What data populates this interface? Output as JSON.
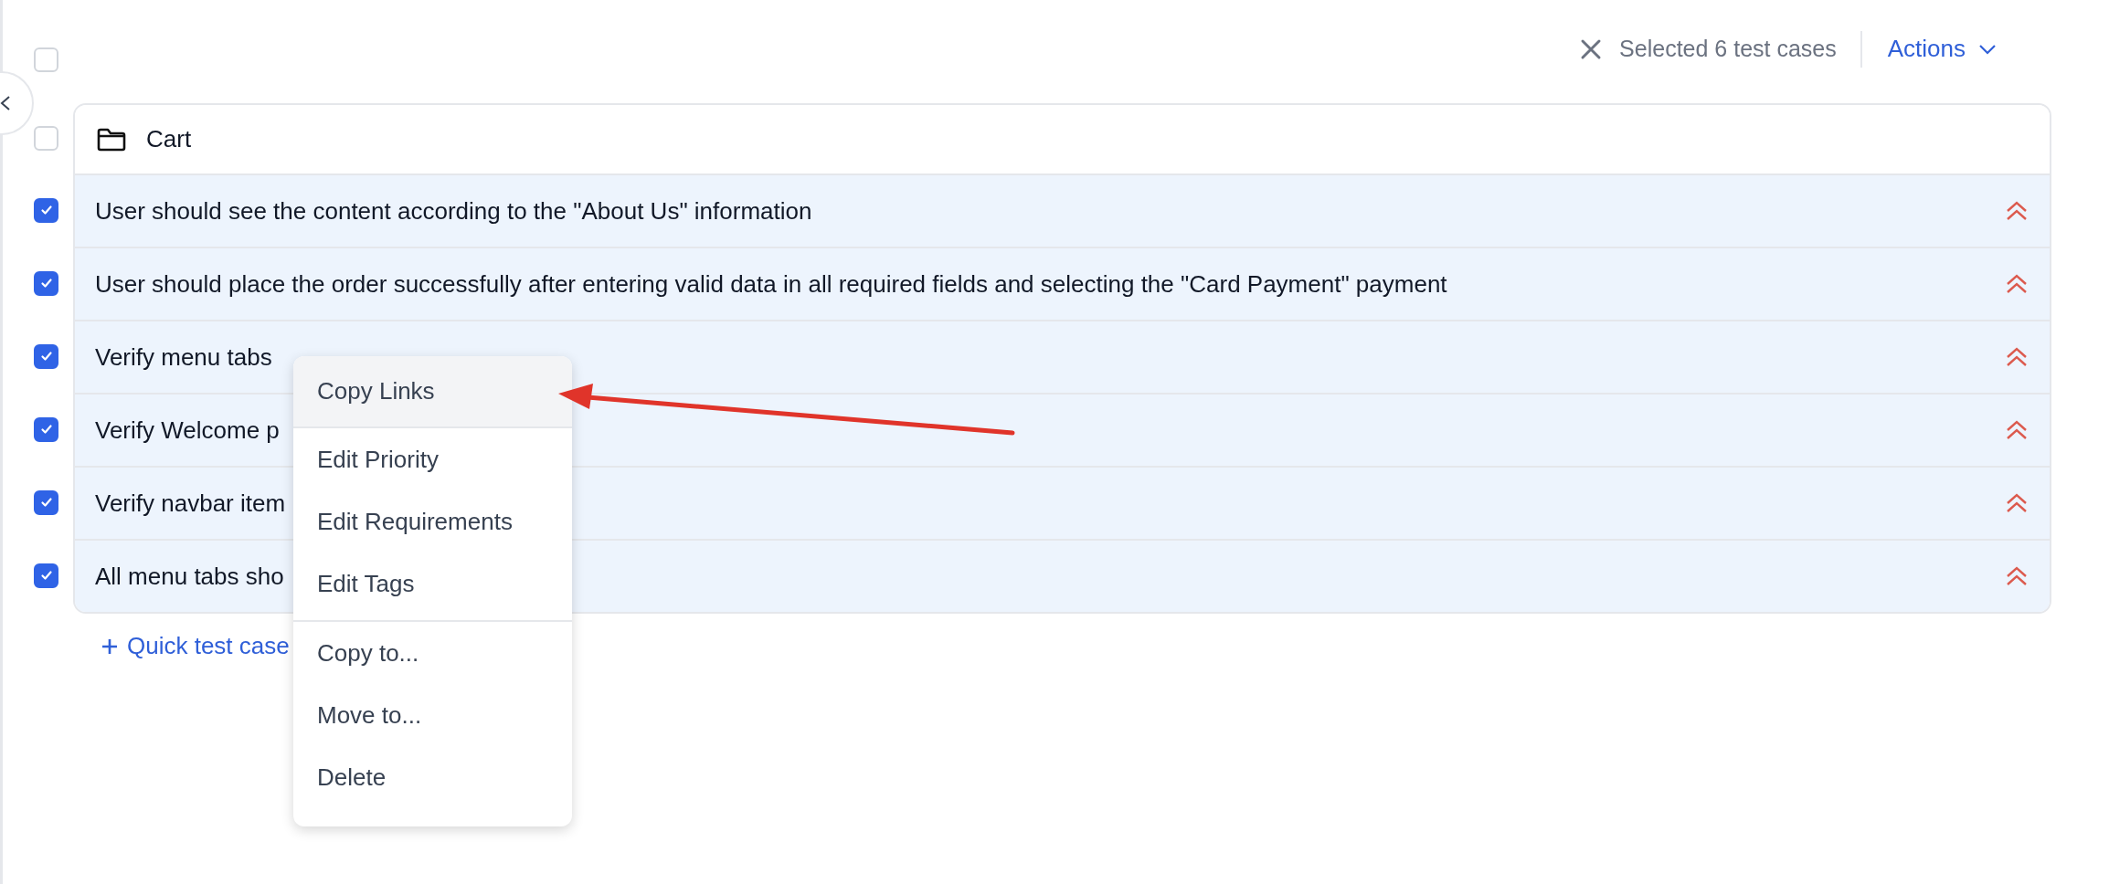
{
  "toolbar": {
    "select_all": {
      "checked": false
    },
    "selection_text": "Selected 6 test cases",
    "actions_label": "Actions"
  },
  "folder": {
    "name": "Cart",
    "checked": false
  },
  "test_cases": [
    {
      "title": "User should see the content according to the \"About Us\" information",
      "checked": true
    },
    {
      "title": "User should place the order successfully after entering valid data in all required fields and selecting the \"Card Payment\" payment",
      "checked": true
    },
    {
      "title": "Verify menu tabs",
      "checked": true
    },
    {
      "title": "Verify Welcome p",
      "checked": true
    },
    {
      "title": "Verify navbar item",
      "checked": true
    },
    {
      "title": "All menu tabs sho",
      "checked": true
    }
  ],
  "quick_add": {
    "label": "Quick test case"
  },
  "context_menu": {
    "groups": [
      [
        {
          "label": "Copy Links",
          "selected": true
        }
      ],
      [
        {
          "label": "Edit Priority",
          "selected": false
        },
        {
          "label": "Edit Requirements",
          "selected": false
        },
        {
          "label": "Edit Tags",
          "selected": false
        }
      ],
      [
        {
          "label": "Copy to...",
          "selected": false
        },
        {
          "label": "Move to...",
          "selected": false
        },
        {
          "label": "Delete",
          "selected": false
        }
      ]
    ]
  }
}
